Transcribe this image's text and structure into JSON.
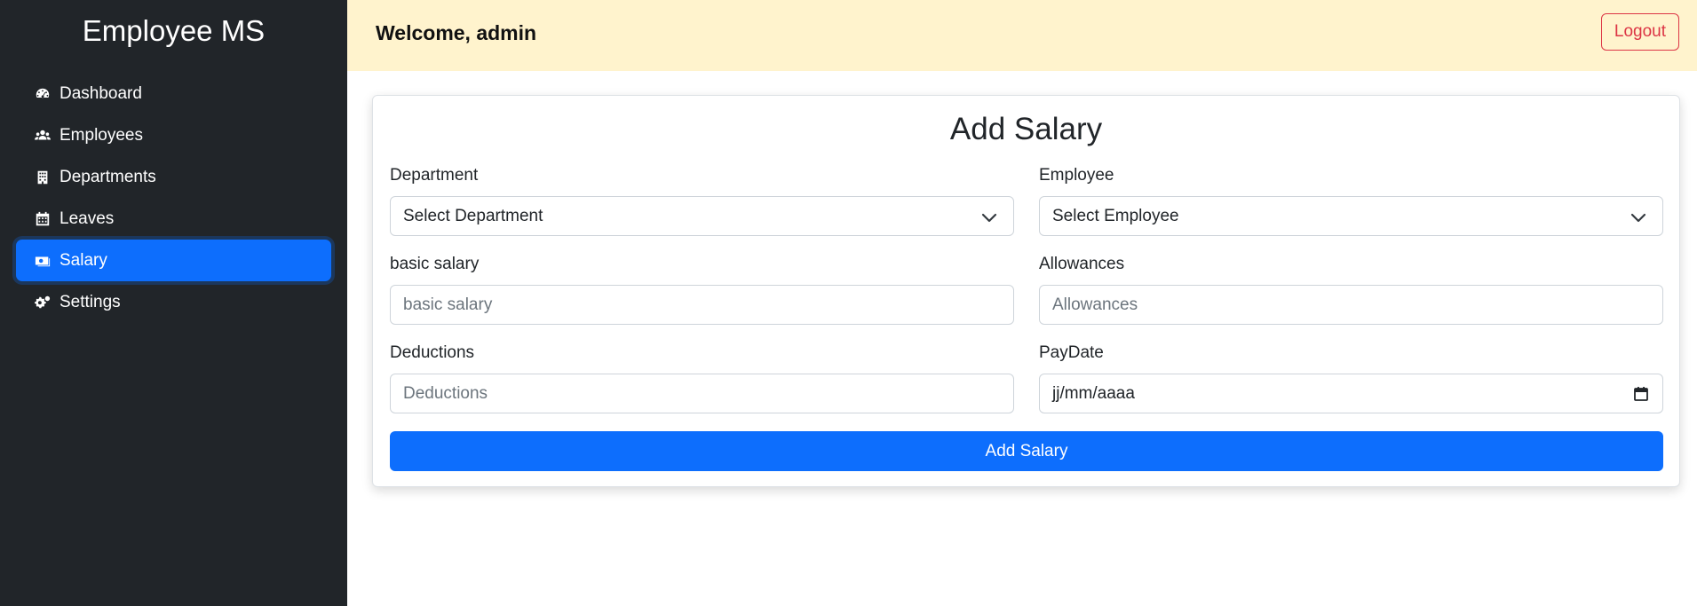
{
  "sidebar": {
    "brand": "Employee MS",
    "items": [
      {
        "label": "Dashboard",
        "icon": "tachometer-icon"
      },
      {
        "label": "Employees",
        "icon": "users-icon"
      },
      {
        "label": "Departments",
        "icon": "building-icon"
      },
      {
        "label": "Leaves",
        "icon": "calendar-icon"
      },
      {
        "label": "Salary",
        "icon": "money-bill-icon",
        "active": true
      },
      {
        "label": "Settings",
        "icon": "cogs-icon"
      }
    ]
  },
  "header": {
    "welcome": "Welcome, admin",
    "logout_label": "Logout"
  },
  "form": {
    "title": "Add Salary",
    "department": {
      "label": "Department",
      "value": "Select Department"
    },
    "employee": {
      "label": "Employee",
      "value": "Select Employee"
    },
    "basic_salary": {
      "label": "basic salary",
      "placeholder": "basic salary"
    },
    "allowances": {
      "label": "Allowances",
      "placeholder": "Allowances"
    },
    "deductions": {
      "label": "Deductions",
      "placeholder": "Deductions"
    },
    "paydate": {
      "label": "PayDate",
      "value": "jj/mm/aaaa"
    },
    "submit_label": "Add Salary"
  },
  "colors": {
    "sidebar_bg": "#212529",
    "active_item": "#0d6efd",
    "header_bg": "#fff3cd",
    "logout": "#dc3545",
    "primary_button": "#0d6efd"
  }
}
